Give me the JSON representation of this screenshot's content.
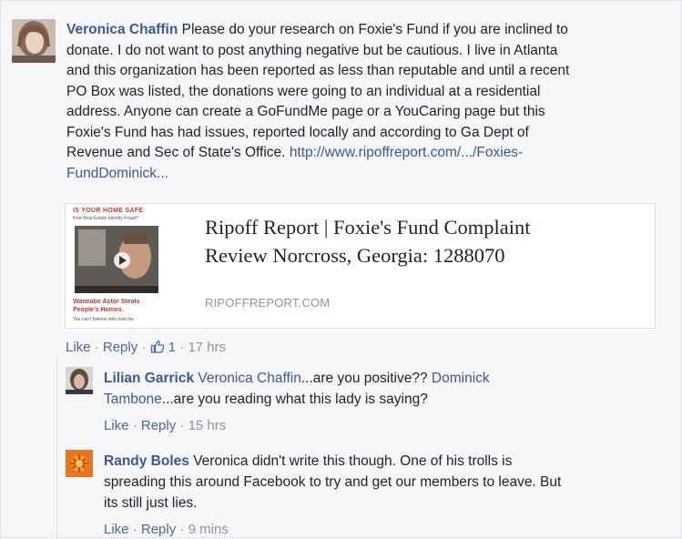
{
  "main_comment": {
    "author": "Veronica Chaffin",
    "text_lines": [
      "Please do your research on Foxie's Fund if you are inclined to",
      "donate. I do not want to post anything negative but be cautious. I live in Atlanta",
      "and this organization has been reported as less than reputable and until a recent",
      "PO Box was listed, the donations were going to an individual at a residential",
      "address. Anyone can create a GoFundMe page or a YouCaring page but this",
      "Foxie's Fund has had issues, reported locally and according to Ga Dept of",
      "Revenue and Sec of State's Office."
    ],
    "link_part1": "http://www.ripoffreport.com/.../Foxies-",
    "link_part2": "FundDominick...",
    "link_preview": {
      "title_line1": "Ripoff Report | Foxie's Fund Complaint",
      "title_line2": "Review Norcross, Georgia: 1288070",
      "domain": "RIPOFFREPORT.COM",
      "thumb_headline": "IS YOUR HOME SAFE",
      "thumb_sub": "from Real Estate Identity Fraud?",
      "thumb_caption1": "Wannabe Actor Steals",
      "thumb_caption2": "People's Homes.",
      "thumb_caption3": "You can't believe who took his"
    },
    "actions": {
      "like": "Like",
      "reply": "Reply",
      "like_count": "1",
      "time": "17 hrs",
      "dot": "·"
    }
  },
  "replies": [
    {
      "author": "Lilian Garrick",
      "mention1": "Veronica Chaffin",
      "text1": "...are you positive??",
      "mention2_part1": "Dominick",
      "mention2_part2": "Tambone",
      "text2": "...are you reading what this lady is saying?",
      "actions": {
        "like": "Like",
        "reply": "Reply",
        "time": "15 hrs"
      }
    },
    {
      "author": "Randy Boles",
      "text_line1": "Veronica didn't write this though. One of his trolls is",
      "text_line2": "spreading this around Facebook to try and get our members to leave. But",
      "text_line3": "its still just lies.",
      "actions": {
        "like": "Like",
        "reply": "Reply",
        "time": "9 mins"
      }
    }
  ],
  "colors": {
    "link_blue": "#3b5998",
    "meta_gray": "#90949c",
    "background": "#f6f7f9"
  }
}
